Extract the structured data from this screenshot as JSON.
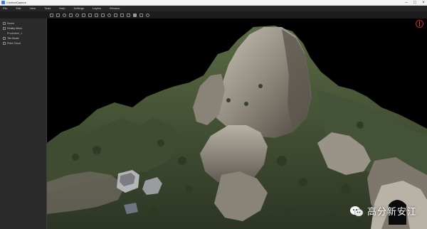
{
  "window": {
    "title": "ContextCapture"
  },
  "menu": {
    "items": [
      "File",
      "Edit",
      "View",
      "Tools",
      "Help",
      "Settings",
      "Layers",
      "Window"
    ]
  },
  "toolbar": {
    "icons": [
      "open-icon",
      "save-icon",
      "select-icon",
      "pan-icon",
      "rotate-icon",
      "zoom-icon",
      "measure-icon",
      "area-icon",
      "profile-icon",
      "camera-icon",
      "light-icon",
      "render-icon",
      "grid-icon",
      "layer-icon",
      "settings-icon",
      "info-icon"
    ]
  },
  "sidebar": {
    "items": [
      {
        "label": "Scene",
        "level": "root"
      },
      {
        "label": "Reality Mesh",
        "level": "root"
      },
      {
        "label": "Production_1",
        "level": "sub"
      },
      {
        "label": "Tile Model",
        "level": "root"
      },
      {
        "label": "Point Cloud",
        "level": "root"
      }
    ]
  },
  "viewport": {
    "compass_icon": "north-arrow-icon"
  },
  "watermark": {
    "text": "高分新安江",
    "icon": "wechat-icon"
  },
  "colors": {
    "background": "#000000",
    "panel": "#2b2b2b",
    "compass": "#e53935"
  }
}
